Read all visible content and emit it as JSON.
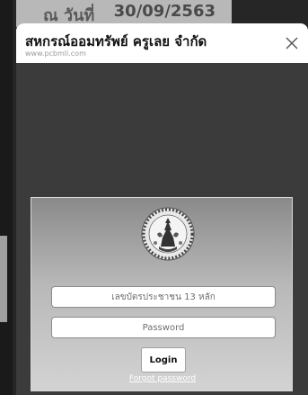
{
  "background": {
    "label": "ณ วันที่",
    "date": "30/09/2563"
  },
  "popup": {
    "title": "สหกรณ์ออมทรัพย์ ครูเลย จำกัด",
    "url": "www.pcbmli.com",
    "close_icon": "close-icon"
  },
  "login": {
    "logo_icon": "cooperative-seal-logo",
    "id_placeholder": "เลขบัตรประชาชน 13 หลัก",
    "password_placeholder": "Password",
    "login_label": "Login",
    "forgot_label": "Forgot password"
  },
  "colors": {
    "overlay": "#3b3b3b",
    "header": "#ffffff",
    "panel_top": "#8a8a8a",
    "panel_bottom": "#d3d3d3"
  }
}
